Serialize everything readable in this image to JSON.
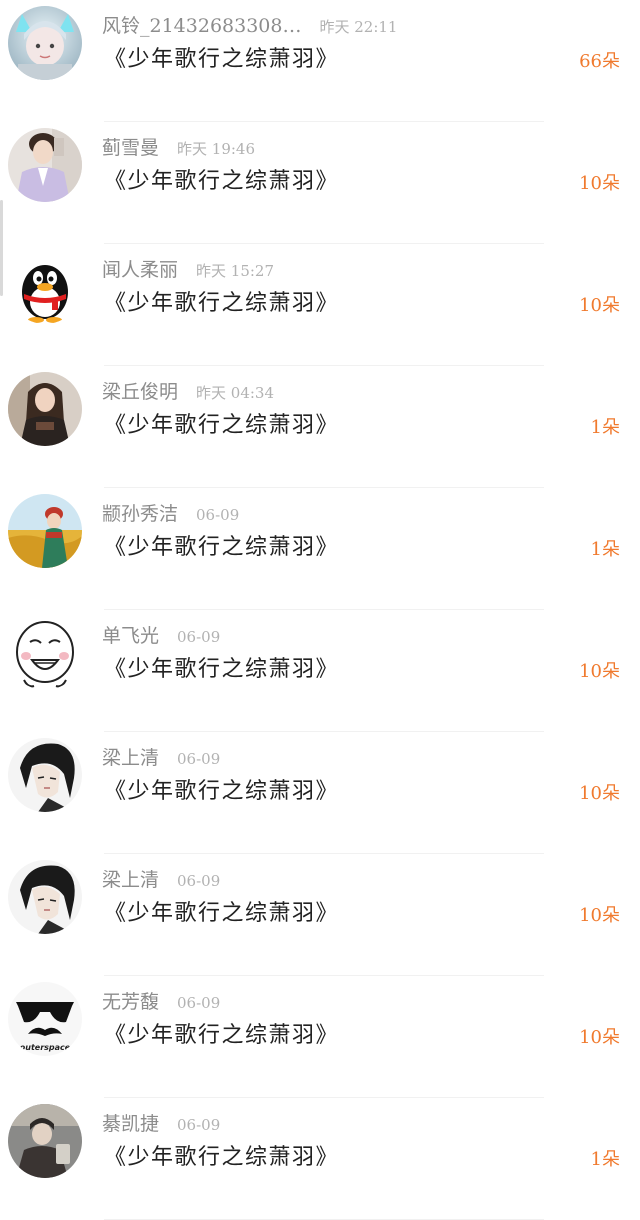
{
  "gifts": [
    {
      "user": "风铃_21432683308…",
      "time": "昨天  22:11",
      "title": "《少年歌行之综萧羽》",
      "count": "66朵",
      "avatar": "cat-ears-photo"
    },
    {
      "user": "蓟雪曼",
      "time": "昨天  19:46",
      "title": "《少年歌行之综萧羽》",
      "count": "10朵",
      "avatar": "boy-lavender-photo"
    },
    {
      "user": "闻人柔丽",
      "time": "昨天  15:27",
      "title": "《少年歌行之综萧羽》",
      "count": "10朵",
      "avatar": "qq-penguin"
    },
    {
      "user": "梁丘俊明",
      "time": "昨天  04:34",
      "title": "《少年歌行之综萧羽》",
      "count": "1朵",
      "avatar": "girl-dark-photo"
    },
    {
      "user": "颛孙秀洁",
      "time": "06-09",
      "title": "《少年歌行之综萧羽》",
      "count": "1朵",
      "avatar": "girl-field-photo"
    },
    {
      "user": "单飞光",
      "time": "06-09",
      "title": "《少年歌行之综萧羽》",
      "count": "10朵",
      "avatar": "meme-face"
    },
    {
      "user": "梁上清",
      "time": "06-09",
      "title": "《少年歌行之综萧羽》",
      "count": "10朵",
      "avatar": "ink-swordsman"
    },
    {
      "user": "梁上清",
      "time": "06-09",
      "title": "《少年歌行之综萧羽》",
      "count": "10朵",
      "avatar": "ink-swordsman"
    },
    {
      "user": "无芳馥",
      "time": "06-09",
      "title": "《少年歌行之综萧羽》",
      "count": "10朵",
      "avatar": "sunglasses-mustache",
      "avatar_text": "outerspace"
    },
    {
      "user": "綦凯捷",
      "time": "06-09",
      "title": "《少年歌行之综萧羽》",
      "count": "1朵",
      "avatar": "dim-photo"
    }
  ],
  "colors": {
    "count": "#f07a2e",
    "title": "#222222",
    "username": "#8c8c8c",
    "time": "#b2b2b2"
  }
}
